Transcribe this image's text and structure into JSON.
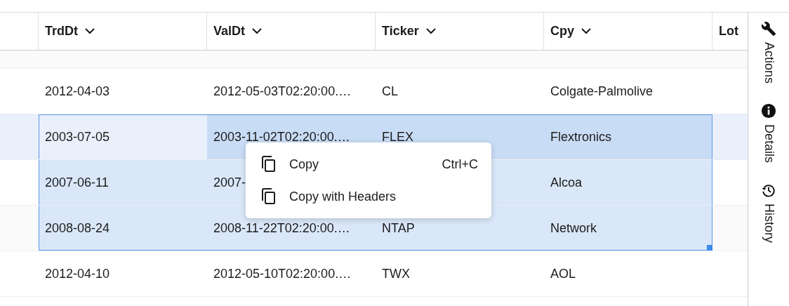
{
  "columns": [
    {},
    {
      "label": "TrdDt",
      "sortable": true
    },
    {
      "label": "ValDt",
      "sortable": true
    },
    {
      "label": "Ticker",
      "sortable": true
    },
    {
      "label": "Cpy",
      "sortable": true
    },
    {
      "label": "Lot",
      "sortable": false
    }
  ],
  "rows": [
    {
      "hovered": false,
      "cells": [
        {
          "text": "2012-04-03",
          "selected": false
        },
        {
          "text": "2012-05-03T02:20:00.…",
          "selected": false
        },
        {
          "text": "CL",
          "selected": false
        },
        {
          "text": "Colgate-Palmolive",
          "selected": false
        }
      ]
    },
    {
      "hovered": true,
      "cells": [
        {
          "text": "2003-07-05",
          "selected": true,
          "focused": true
        },
        {
          "text": "2003-11-02T02:20:00.…",
          "selected": true,
          "focused": false
        },
        {
          "text": "FLEX",
          "selected": true,
          "focused": false
        },
        {
          "text": "Flextronics",
          "selected": true,
          "focused": false
        }
      ]
    },
    {
      "hovered": false,
      "cells": [
        {
          "text": "2007-06-11",
          "selected": true,
          "focused": false
        },
        {
          "text": "2007-",
          "selected": true,
          "focused": false
        },
        {
          "selected": true,
          "focused": false
        },
        {
          "text": "Alcoa",
          "selected": true,
          "focused": false
        }
      ]
    },
    {
      "hovered": false,
      "cells": [
        {
          "text": "2008-08-24",
          "selected": true,
          "focused": false
        },
        {
          "text": "2008-11-22T02:20:00.…",
          "selected": true,
          "focused": false
        },
        {
          "text": "NTAP",
          "selected": true,
          "focused": false
        },
        {
          "text": "Network",
          "selected": true,
          "focused": false
        }
      ]
    },
    {
      "hovered": false,
      "cells": [
        {
          "text": "2012-04-10",
          "selected": false
        },
        {
          "text": "2012-05-10T02:20:00.…",
          "selected": false
        },
        {
          "text": "TWX",
          "selected": false
        },
        {
          "text": "AOL",
          "selected": false
        }
      ]
    }
  ],
  "context_menu": {
    "items": [
      {
        "label": "Copy",
        "shortcut": "Ctrl+C"
      },
      {
        "label": "Copy with Headers"
      }
    ]
  },
  "side_tabs": [
    {
      "kind": "actions",
      "label": "Actions"
    },
    {
      "kind": "details",
      "label": "Details"
    },
    {
      "kind": "history",
      "label": "History"
    }
  ]
}
